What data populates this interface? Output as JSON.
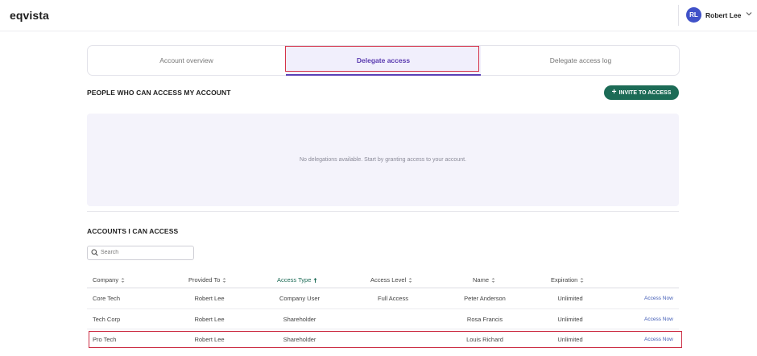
{
  "header": {
    "logo": "eqvista",
    "user_initials": "RL",
    "user_name": "Robert Lee"
  },
  "tabs": [
    {
      "label": "Account overview",
      "active": false
    },
    {
      "label": "Delegate access",
      "active": true
    },
    {
      "label": "Delegate access log",
      "active": false
    }
  ],
  "delegations": {
    "title": "PEOPLE WHO CAN ACCESS MY ACCOUNT",
    "invite_label": "INVITE TO ACCESS",
    "empty_message": "No delegations available. Start by granting access to your account."
  },
  "accounts": {
    "title": "ACCOUNTS I CAN ACCESS",
    "search_placeholder": "Search",
    "columns": [
      "Company",
      "Provided To",
      "Access Type",
      "Access Level",
      "Name",
      "Expiration"
    ],
    "sorted_column": "Access Type",
    "rows": [
      {
        "company": "Core Tech",
        "provided_to": "Robert Lee",
        "access_type": "Company User",
        "access_level": "Full Access",
        "name": "Peter Anderson",
        "expiration": "Unlimited",
        "action": "Access Now"
      },
      {
        "company": "Tech Corp",
        "provided_to": "Robert Lee",
        "access_type": "Shareholder",
        "access_level": "",
        "name": "Rosa Francis",
        "expiration": "Unlimited",
        "action": "Access Now"
      },
      {
        "company": "Pro Tech",
        "provided_to": "Robert Lee",
        "access_type": "Shareholder",
        "access_level": "",
        "name": "Louis Richard",
        "expiration": "Unlimited",
        "action": "Access Now"
      }
    ]
  },
  "colors": {
    "accent_green": "#1c6b56",
    "active_tab": "#5a3ab0",
    "highlight": "#d5334a",
    "link": "#3f5ab5"
  }
}
